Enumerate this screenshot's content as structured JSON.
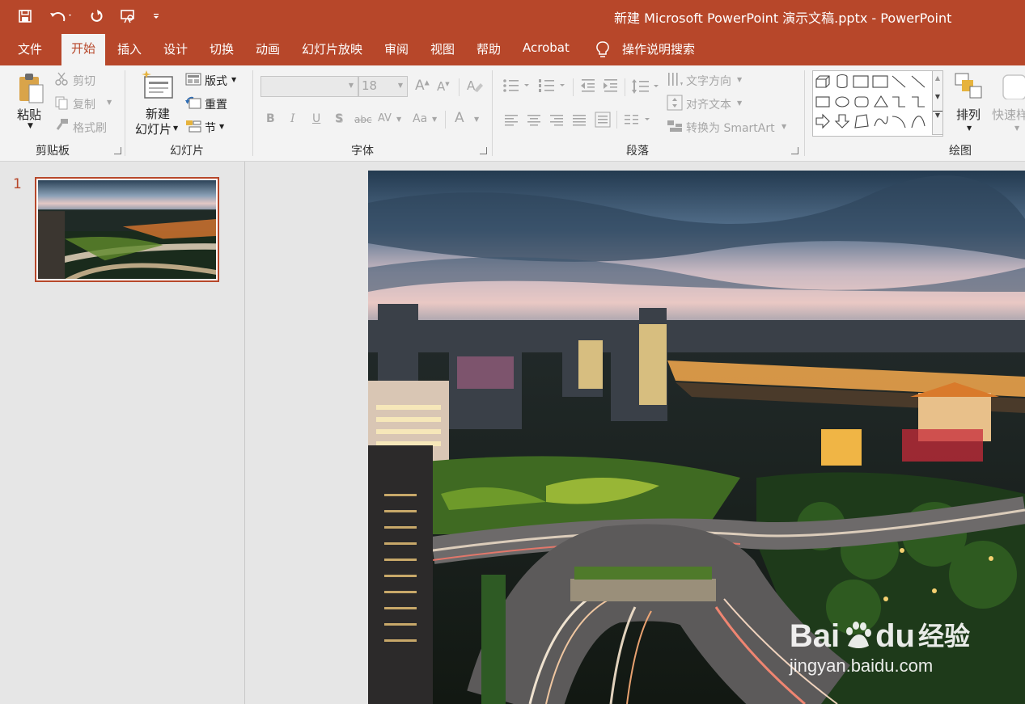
{
  "window": {
    "title": "新建 Microsoft PowerPoint 演示文稿.pptx  -  PowerPoint"
  },
  "quick_access": [
    "save-icon",
    "undo-icon",
    "redo-icon",
    "present-icon",
    "customize-icon"
  ],
  "tabs": [
    "文件",
    "开始",
    "插入",
    "设计",
    "切换",
    "动画",
    "幻灯片放映",
    "审阅",
    "视图",
    "帮助",
    "Acrobat"
  ],
  "active_tab": "开始",
  "tell_me": {
    "label": "操作说明搜索",
    "icon": "lightbulb-icon"
  },
  "ribbon": {
    "clipboard": {
      "group_label": "剪贴板",
      "paste": "粘贴",
      "cut": "剪切",
      "copy": "复制",
      "format_painter": "格式刷"
    },
    "slides": {
      "group_label": "幻灯片",
      "new_slide_line1": "新建",
      "new_slide_line2": "幻灯片",
      "layout": "版式",
      "reset": "重置",
      "section": "节"
    },
    "font": {
      "group_label": "字体",
      "font_name": "",
      "font_size": "18",
      "bold": "B",
      "italic": "I",
      "underline": "U",
      "shadow": "S",
      "strike": "abc",
      "spacing": "AV",
      "case": "Aa",
      "color": "A"
    },
    "paragraph": {
      "group_label": "段落",
      "text_direction": "文字方向",
      "align_text": "对齐文本",
      "smartart": "转换为 SmartArt"
    },
    "drawing": {
      "group_label": "绘图",
      "arrange": "排列",
      "quick_styles": "快速样"
    }
  },
  "slides_panel": {
    "slide_number": "1"
  },
  "watermark": {
    "brand_a": "Bai",
    "brand_b": "du",
    "cn": "经验",
    "url": "jingyan.baidu.com"
  },
  "colors": {
    "accent": "#b7472a",
    "ribbon_bg": "#f3f3f3",
    "workspace_bg": "#e6e6e6"
  }
}
